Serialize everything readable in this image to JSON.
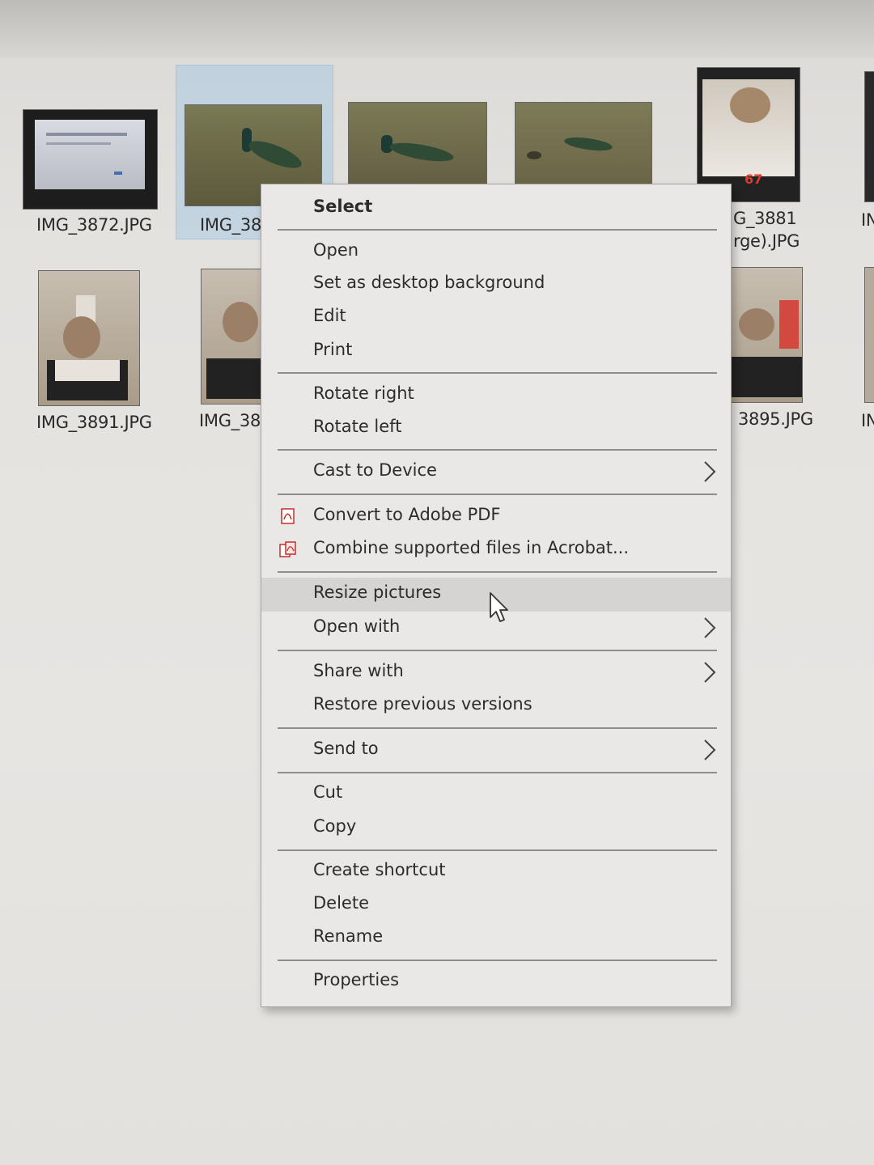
{
  "files": [
    {
      "name": "IMG_3872.JPG"
    },
    {
      "name": "IMG_38"
    },
    {
      "name": "G_3881"
    },
    {
      "name": "rge).JPG"
    },
    {
      "name": "IMG_3891.JPG"
    },
    {
      "name": "IMG_38"
    },
    {
      "name": "3895.JPG"
    },
    {
      "name": "IN"
    },
    {
      "name": "IN"
    }
  ],
  "thumb_overlay_text": "67",
  "context_menu": {
    "select": "Select",
    "open": "Open",
    "set_desktop_bg": "Set as desktop background",
    "edit": "Edit",
    "print": "Print",
    "rotate_right": "Rotate right",
    "rotate_left": "Rotate left",
    "cast_to_device": "Cast to Device",
    "convert_pdf": "Convert to Adobe PDF",
    "combine_acrobat": "Combine supported files in Acrobat...",
    "resize_pictures": "Resize pictures",
    "open_with": "Open with",
    "share_with": "Share with",
    "restore_versions": "Restore previous versions",
    "send_to": "Send to",
    "cut": "Cut",
    "copy": "Copy",
    "create_shortcut": "Create shortcut",
    "delete": "Delete",
    "rename": "Rename",
    "properties": "Properties"
  },
  "highlighted_item": "Resize pictures",
  "colors": {
    "menu_bg": "#e9e8e6",
    "highlight": "#d6d4d3",
    "selection": "#aac8e1",
    "pdf_icon": "#c0302a"
  }
}
